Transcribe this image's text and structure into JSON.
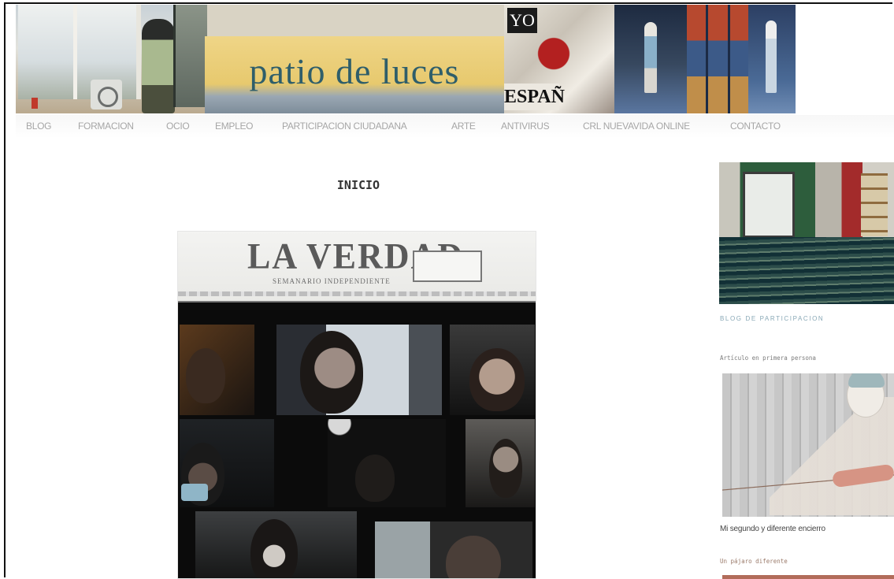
{
  "site": {
    "title": "patio de luces"
  },
  "nav": {
    "items": [
      "BLOG",
      "FORMACION",
      "OCIO",
      "EMPLEO",
      "PARTICIPACION CIUDADANA",
      "ARTE",
      "ANTIVIRUS",
      "CRL NUEVAVIDA ONLINE",
      "CONTACTO"
    ]
  },
  "main": {
    "page_title": "INICIO",
    "image": {
      "newspaper_title": "LA VERDAD",
      "newspaper_subtitle": "SEMANARIO INDEPENDIENTE"
    }
  },
  "sidebar": {
    "blog_link": "BLOG DE PARTICIPACION",
    "section_heading": "Artículo en primera persona",
    "article_caption": "Mi segundo y diferente encierro",
    "next_heading": "Un pájaro diferente"
  },
  "colors": {
    "title": "#2f5e6a",
    "nav_text": "#a6a6a6",
    "sidebar_link": "#8aa9b7"
  }
}
